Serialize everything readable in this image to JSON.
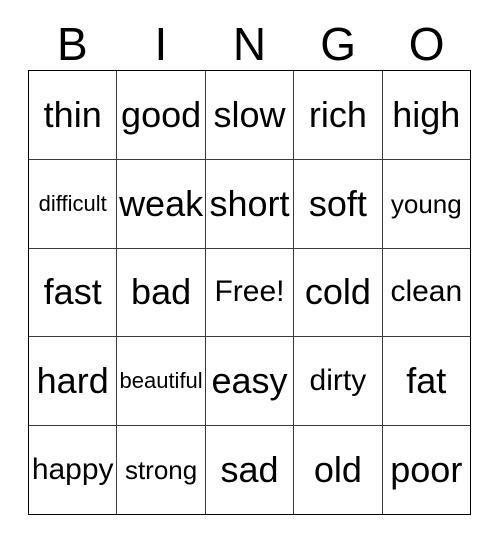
{
  "card": {
    "title": "BINGO",
    "header_letters": [
      "B",
      "I",
      "N",
      "G",
      "O"
    ],
    "free_space_label": "Free!",
    "colors": {
      "background": "#ffffff",
      "text": "#000000",
      "grid_line": "#3a3a3a",
      "outer_border": "#000000"
    },
    "rows": [
      [
        {
          "text": "thin",
          "size": "fs-lg"
        },
        {
          "text": "good",
          "size": "fs-lg"
        },
        {
          "text": "slow",
          "size": "fs-lg"
        },
        {
          "text": "rich",
          "size": "fs-lg"
        },
        {
          "text": "high",
          "size": "fs-lg"
        }
      ],
      [
        {
          "text": "difficult",
          "size": "fs-xs"
        },
        {
          "text": "weak",
          "size": "fs-lg"
        },
        {
          "text": "short",
          "size": "fs-lg"
        },
        {
          "text": "soft",
          "size": "fs-lg"
        },
        {
          "text": "young",
          "size": "fs-sm"
        }
      ],
      [
        {
          "text": "fast",
          "size": "fs-lg"
        },
        {
          "text": "bad",
          "size": "fs-lg"
        },
        {
          "text": "Free!",
          "size": "fs-md"
        },
        {
          "text": "cold",
          "size": "fs-lg"
        },
        {
          "text": "clean",
          "size": "fs-md"
        }
      ],
      [
        {
          "text": "hard",
          "size": "fs-lg"
        },
        {
          "text": "beautiful",
          "size": "fs-xs"
        },
        {
          "text": "easy",
          "size": "fs-lg"
        },
        {
          "text": "dirty",
          "size": "fs-md"
        },
        {
          "text": "fat",
          "size": "fs-lg"
        }
      ],
      [
        {
          "text": "happy",
          "size": "fs-md"
        },
        {
          "text": "strong",
          "size": "fs-sm"
        },
        {
          "text": "sad",
          "size": "fs-lg"
        },
        {
          "text": "old",
          "size": "fs-lg"
        },
        {
          "text": "poor",
          "size": "fs-lg"
        }
      ]
    ]
  }
}
